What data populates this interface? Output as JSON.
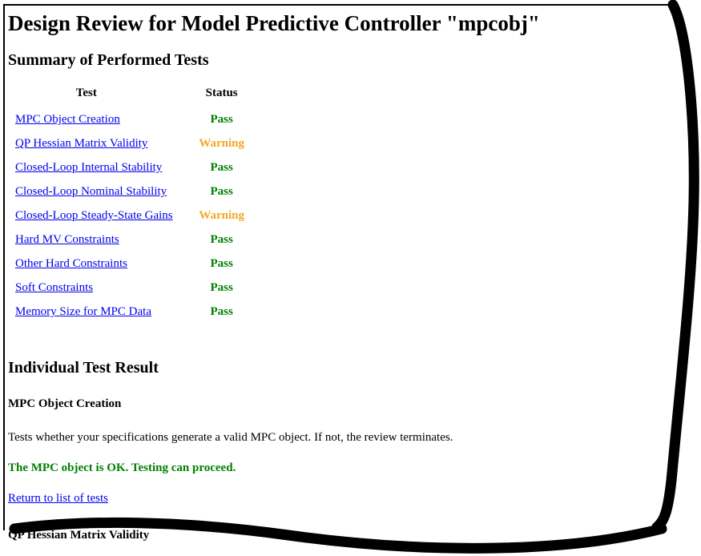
{
  "document": {
    "title": "Design Review for Model Predictive Controller \"mpcobj\"",
    "summary_heading": "Summary of Performed Tests",
    "individual_heading": "Individual Test Result"
  },
  "colors": {
    "link": "#0000ee",
    "pass": "#008000",
    "warning": "#f5a623",
    "text": "#000000",
    "background": "#ffffff",
    "frame": "#000000"
  },
  "summary_table": {
    "headers": [
      "Test",
      "Status"
    ],
    "rows": [
      {
        "test": "MPC Object Creation",
        "status": "Pass"
      },
      {
        "test": "QP Hessian Matrix Validity",
        "status": "Warning"
      },
      {
        "test": "Closed-Loop Internal Stability",
        "status": "Pass"
      },
      {
        "test": "Closed-Loop Nominal Stability",
        "status": "Pass"
      },
      {
        "test": "Closed-Loop Steady-State Gains",
        "status": "Warning"
      },
      {
        "test": "Hard MV Constraints",
        "status": "Pass"
      },
      {
        "test": "Other Hard Constraints",
        "status": "Pass"
      },
      {
        "test": "Soft Constraints",
        "status": "Pass"
      },
      {
        "test": "Memory Size for MPC Data",
        "status": "Pass"
      }
    ]
  },
  "individual_tests": [
    {
      "name": "MPC Object Creation",
      "description": "Tests whether your specifications generate a valid MPC object. If not, the review terminates.",
      "verdict": "The MPC object is OK. Testing can proceed.",
      "return_link": "Return to list of tests"
    },
    {
      "name": "QP Hessian Matrix Validity"
    }
  ]
}
